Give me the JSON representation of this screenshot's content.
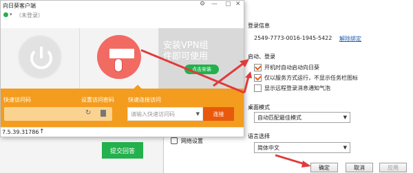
{
  "client": {
    "title": "向日葵客户端",
    "status": "（未登录）",
    "vpn_ad_title": "安装VPN组",
    "vpn_ad_sub": "件即可使用",
    "vpn_install_button": "点击安装",
    "quick_code_label": "快速访问码",
    "set_code_label": "设置访问密码",
    "connect_label": "快速连接访问",
    "connect_placeholder": "请输入快速访问码",
    "connect_button": "连接",
    "ip_text": "7.5.39.31786",
    "bottom_hint": "网络设置",
    "submit_button": "提交回答"
  },
  "settings": {
    "login_info_title": "登录信息",
    "device_id": "2549-7773-0016-1945-5422",
    "unbind_link": "解除绑定",
    "startup_title": "启动、登录",
    "options": [
      {
        "label": "开机时自动启动向日葵",
        "checked": true
      },
      {
        "label": "仅以服务方式运行，不显示任务栏图标",
        "checked": true
      },
      {
        "label": "显示远程登录消息通知气泡",
        "checked": false
      }
    ],
    "desktop_mode_title": "桌面模式",
    "desktop_mode_value": "自动匹配最佳模式",
    "language_title": "语言选择",
    "language_value": "简体中文",
    "ok_button": "确定",
    "cancel_button": "取消",
    "apply_button": "应用"
  },
  "colors": {
    "accent_orange": "#f39c1e",
    "arrow_red": "#e03a3a",
    "green": "#23b14d",
    "link_blue": "#1a5fb4"
  }
}
